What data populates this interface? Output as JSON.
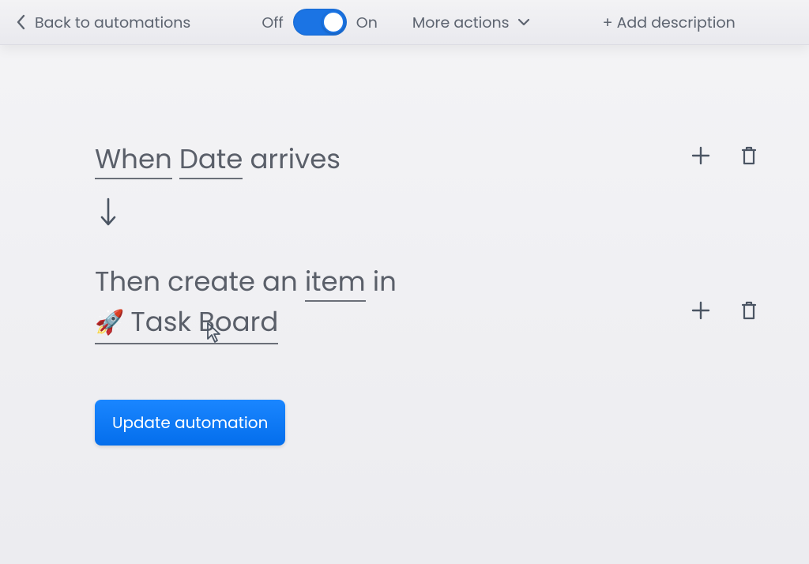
{
  "topbar": {
    "back_label": "Back to automations",
    "off_label": "Off",
    "on_label": "On",
    "toggle_state": "on",
    "more_actions_label": "More actions",
    "add_description_label": "+ Add description"
  },
  "trigger": {
    "when_text": "When",
    "field_token": "Date",
    "arrives_text": "arrives"
  },
  "action": {
    "then_text": "Then create an",
    "item_token": "item",
    "in_text": "in",
    "board_emoji": "🚀",
    "board_name": "Task Board"
  },
  "buttons": {
    "update_label": "Update automation"
  },
  "icons": {
    "back_chevron": "chevron-left-icon",
    "dropdown_chevron": "chevron-down-icon",
    "flow_arrow": "arrow-down-icon",
    "plus": "plus-icon",
    "trash": "trash-icon",
    "cursor": "cursor-icon"
  }
}
